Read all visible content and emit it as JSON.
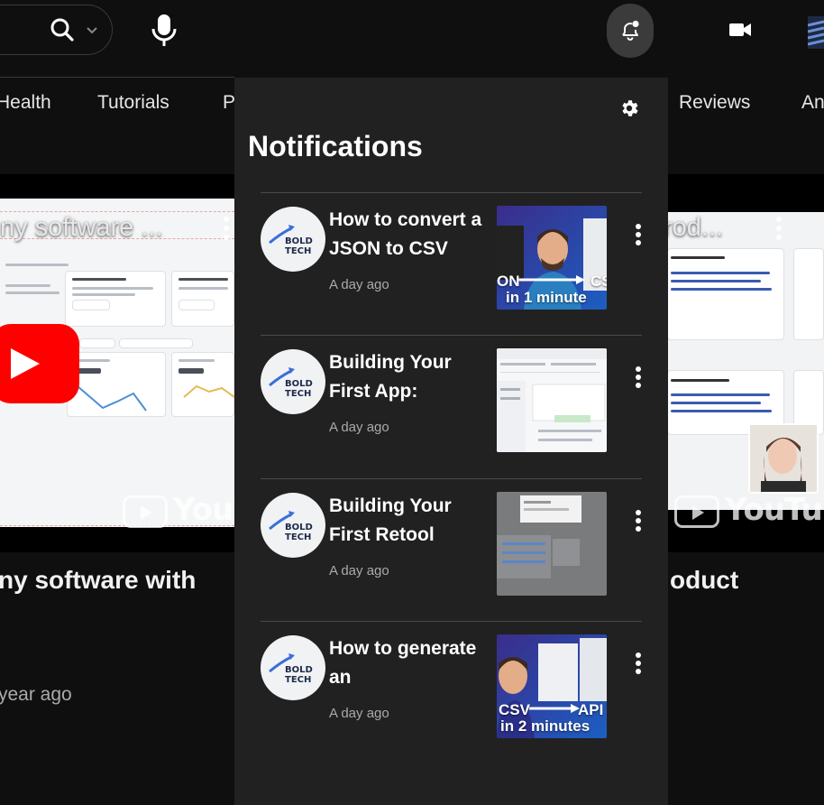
{
  "chips": [
    "Health",
    "Tutorials",
    "P",
    "Reviews",
    "An"
  ],
  "background_videos": {
    "left": {
      "thumb_overlay": "ny software ...",
      "title": "ny software with",
      "meta": "year ago",
      "watermark": "YouTu"
    },
    "right": {
      "thumb_overlay": "rod...",
      "title": "oduct",
      "watermark": "YouTube"
    }
  },
  "notifications": {
    "title": "Notifications",
    "items": [
      {
        "title": "How to convert a JSON to CSV",
        "time": "A day ago",
        "caption_top_left": "ON",
        "caption_top_right": "CS",
        "caption_bottom": "in 1 minute"
      },
      {
        "title": "Building Your First App:",
        "time": "A day ago"
      },
      {
        "title": "Building Your First Retool",
        "time": "A day ago"
      },
      {
        "title": "How to generate an",
        "time": "A day ago",
        "caption_top_left": "CSV",
        "caption_top_right": "API",
        "caption_bottom": "in 2 minutes"
      }
    ],
    "channel_logo_top": "BOLD",
    "channel_logo_bottom": "TECH"
  },
  "colors": {
    "background": "#0f0f0f",
    "panel": "#212121",
    "youtube_red": "#ff0000",
    "logo_blue": "#3b6fd8"
  },
  "icons": [
    "search-icon",
    "chevron-down-icon",
    "microphone-icon",
    "bell-icon",
    "video-camera-icon",
    "gear-icon",
    "more-vert-icon"
  ]
}
